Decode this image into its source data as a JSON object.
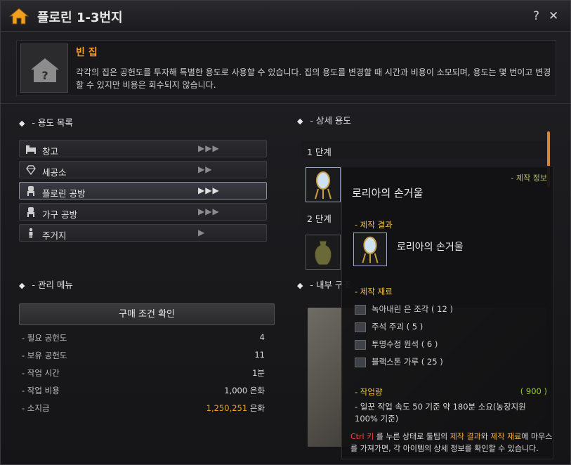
{
  "window": {
    "title": "플로린 1-3번지",
    "help_label": "?",
    "close_label": "✕"
  },
  "info": {
    "title": "빈 집",
    "description": "각각의 집은 공헌도를 투자해 특별한 용도로 사용할 수 있습니다. 집의 용도를 변경할 때 시간과 비용이 소모되며, 용도는 몇 번이고 변경할 수 있지만 비용은 회수되지 않습니다."
  },
  "usage_list": {
    "title": "- 용도 목록",
    "items": [
      {
        "label": "창고",
        "arrows": "▶▶▶",
        "icon": "bed-icon"
      },
      {
        "label": "세공소",
        "arrows": "▶▶",
        "icon": "diamond-icon"
      },
      {
        "label": "플로린 공방",
        "arrows": "▶▶▶",
        "icon": "chair-icon"
      },
      {
        "label": "가구 공방",
        "arrows": "▶▶▶",
        "icon": "chair-icon"
      },
      {
        "label": "주거지",
        "arrows": "▶",
        "icon": "person-icon"
      }
    ]
  },
  "management": {
    "title": "- 관리 메뉴",
    "buy_button": "구매 조건 확인",
    "stats": [
      {
        "key": "- 필요 공헌도",
        "value": "4"
      },
      {
        "key": "- 보유 공헌도",
        "value": "11"
      },
      {
        "key": "- 작업 시간",
        "value": "1분"
      },
      {
        "key": "- 작업 비용",
        "value": "1,000 은화"
      },
      {
        "key": "- 소지금",
        "value_gold": "1,250,251",
        "value_unit": "은화"
      }
    ]
  },
  "detail": {
    "title": "- 상세 용도",
    "stage1": "1 단계",
    "stage2": "2 단계",
    "interior_title": "- 내부 구조"
  },
  "tooltip": {
    "item_name": "로리아의 손거울",
    "tag": "- 제작 정보",
    "result_title": "- 제작 결과",
    "result_name": "로리아의 손거울",
    "materials_title": "- 제작 재료",
    "materials": [
      "녹아내린 은 조각 ( 12 )",
      "주석 주괴 ( 5 )",
      "투명수정 원석 ( 6 )",
      "블랙스톤 가루 ( 25 )"
    ],
    "workload_title": "- 작업량",
    "workload_value": "( 900 )",
    "workload_note": "- 일꾼 작업 속도 50 기준 약 180분 소요(농장지원 100% 기준)",
    "hint_key": "Ctrl 키",
    "hint_text1": " 를 누른 상태로 툴팁의 ",
    "hint_result": "제작 결과",
    "hint_text2": "와 ",
    "hint_materials": "제작 재료",
    "hint_text3": "에 마우스를 가져가면, 각 아이템의 상세 정보를 확인할 수 있습니다."
  }
}
